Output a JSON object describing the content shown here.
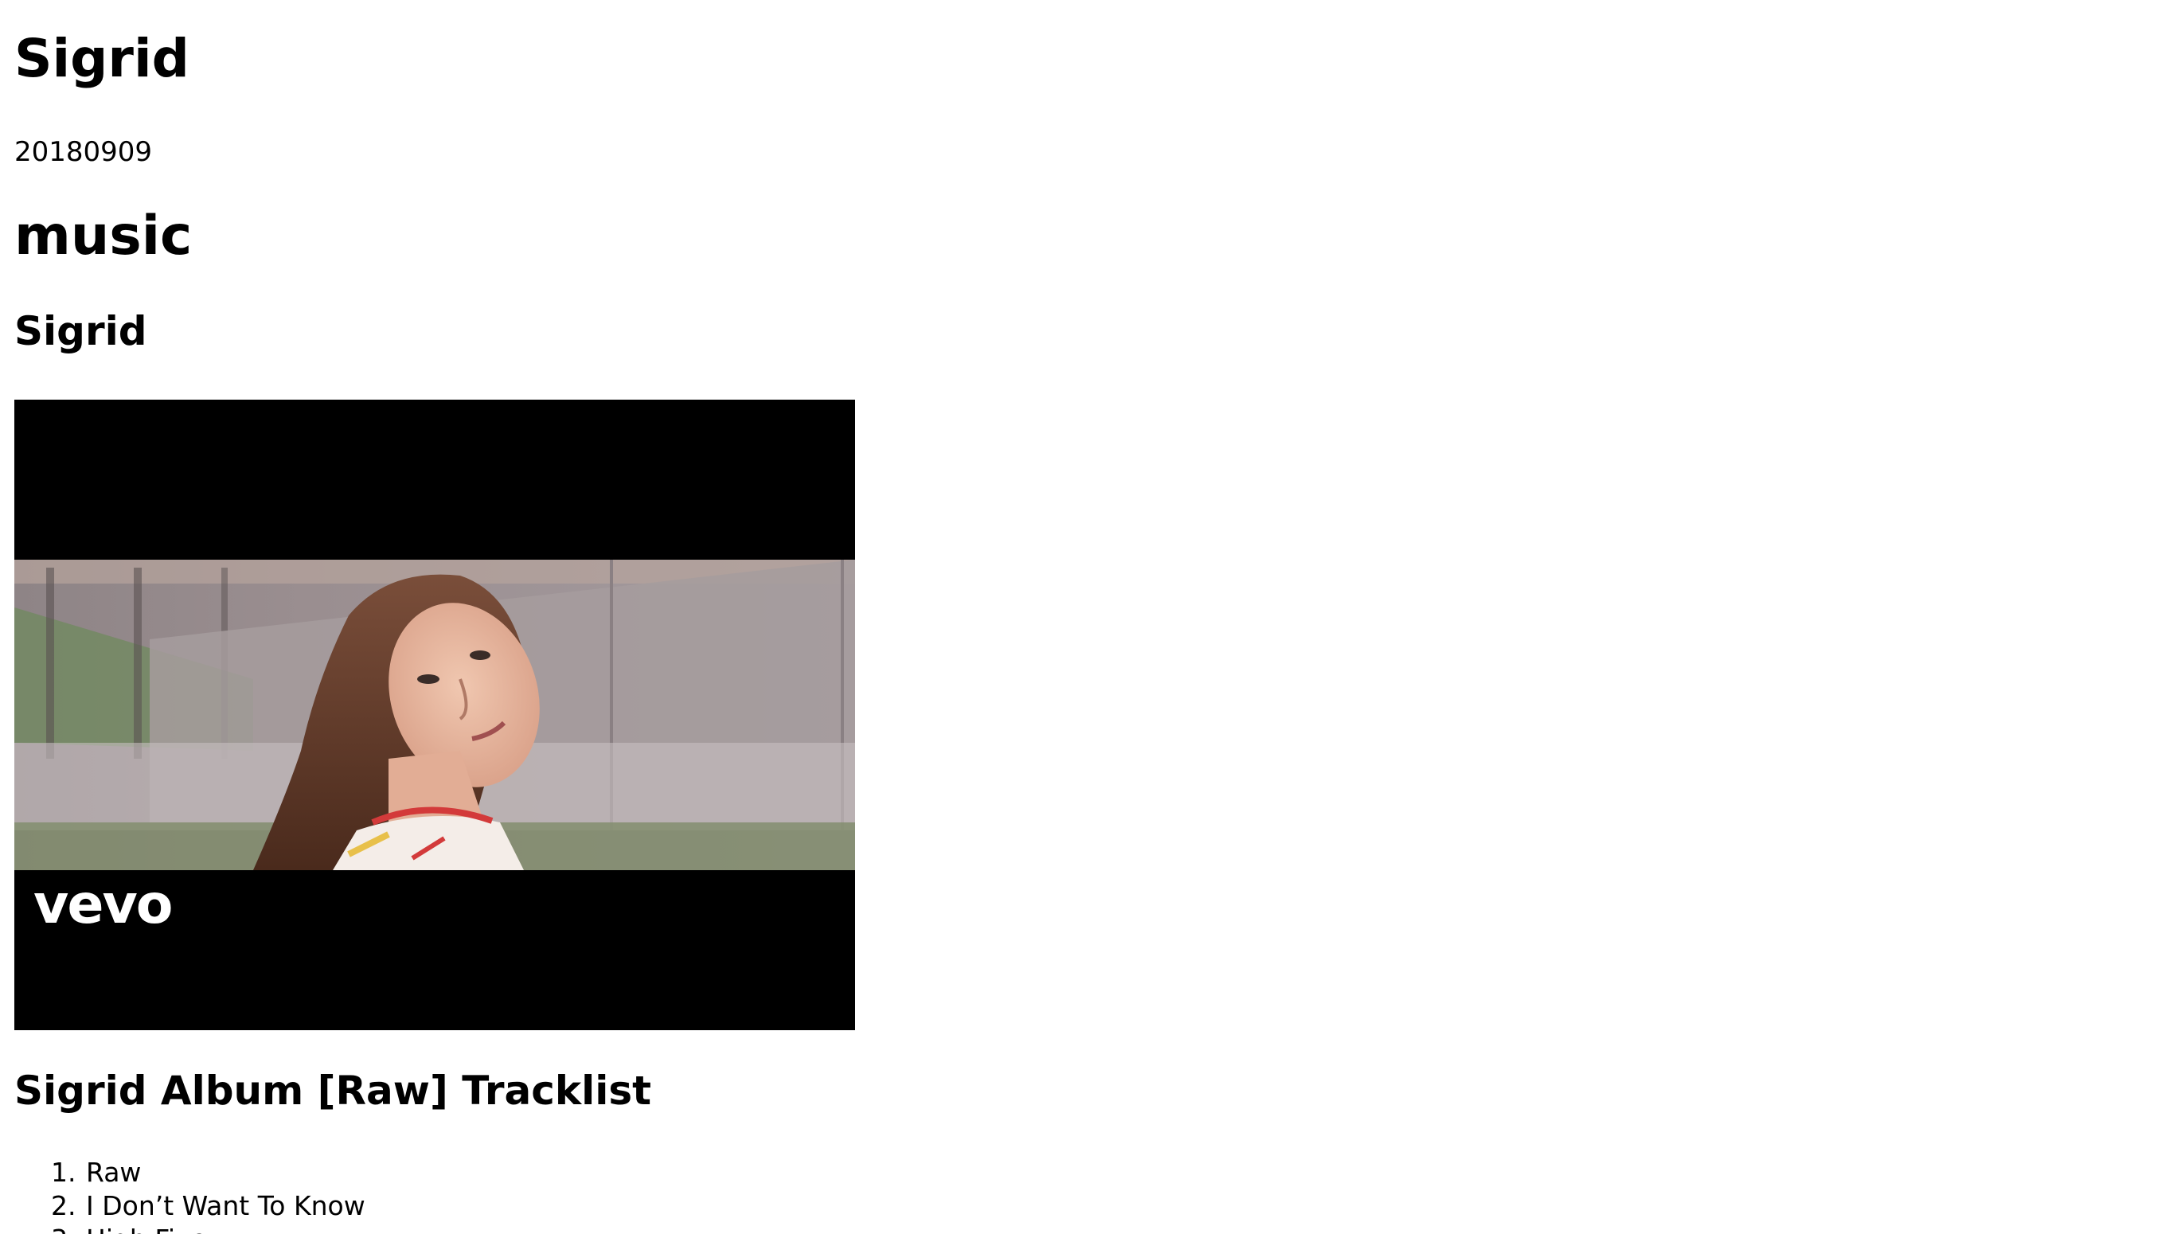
{
  "site_title": "Sigrid",
  "post_date": "20180909",
  "category": "music",
  "artist_heading": "Sigrid",
  "video": {
    "logo_text": "vevo",
    "thumbnail": "woman-portrait-thumbnail"
  },
  "tracklist": {
    "heading": "Sigrid Album [Raw] Tracklist",
    "items": [
      "Raw",
      "I Don’t Want To Know",
      "High Five"
    ]
  }
}
